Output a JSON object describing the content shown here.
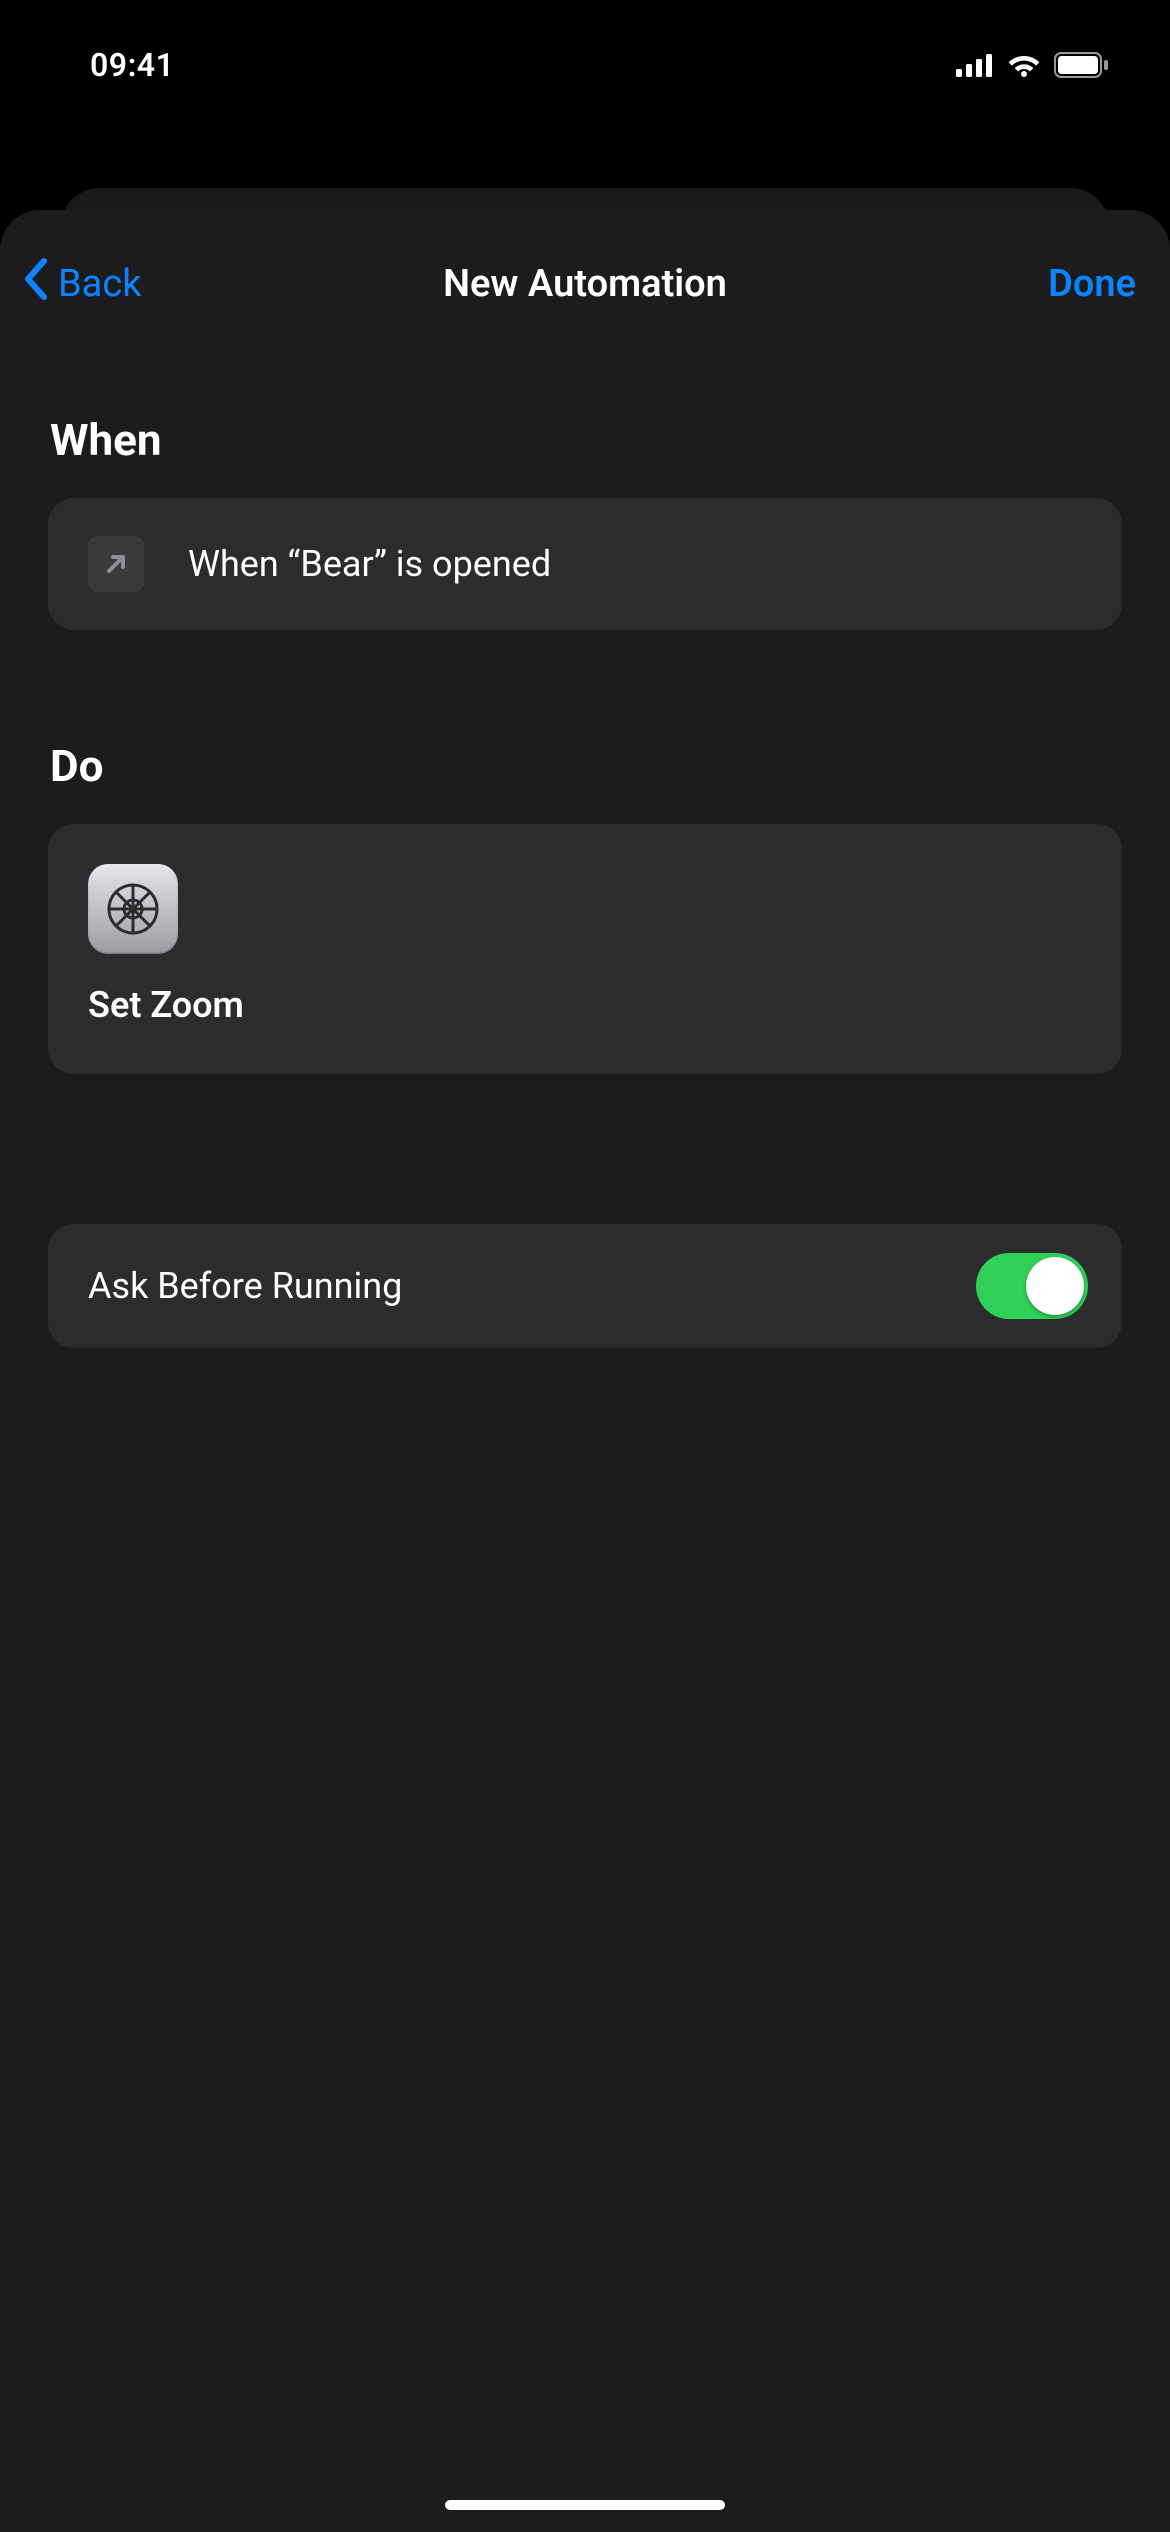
{
  "status": {
    "time": "09:41"
  },
  "nav": {
    "back_label": "Back",
    "title": "New Automation",
    "done_label": "Done"
  },
  "sections": {
    "when_header": "When",
    "when_trigger": "When “Bear” is opened",
    "do_header": "Do",
    "action_label": "Set Zoom"
  },
  "options": {
    "ask_before_running_label": "Ask Before Running",
    "ask_before_running_value": true
  },
  "colors": {
    "accent": "#0a84ff",
    "toggle_on": "#30d158"
  }
}
